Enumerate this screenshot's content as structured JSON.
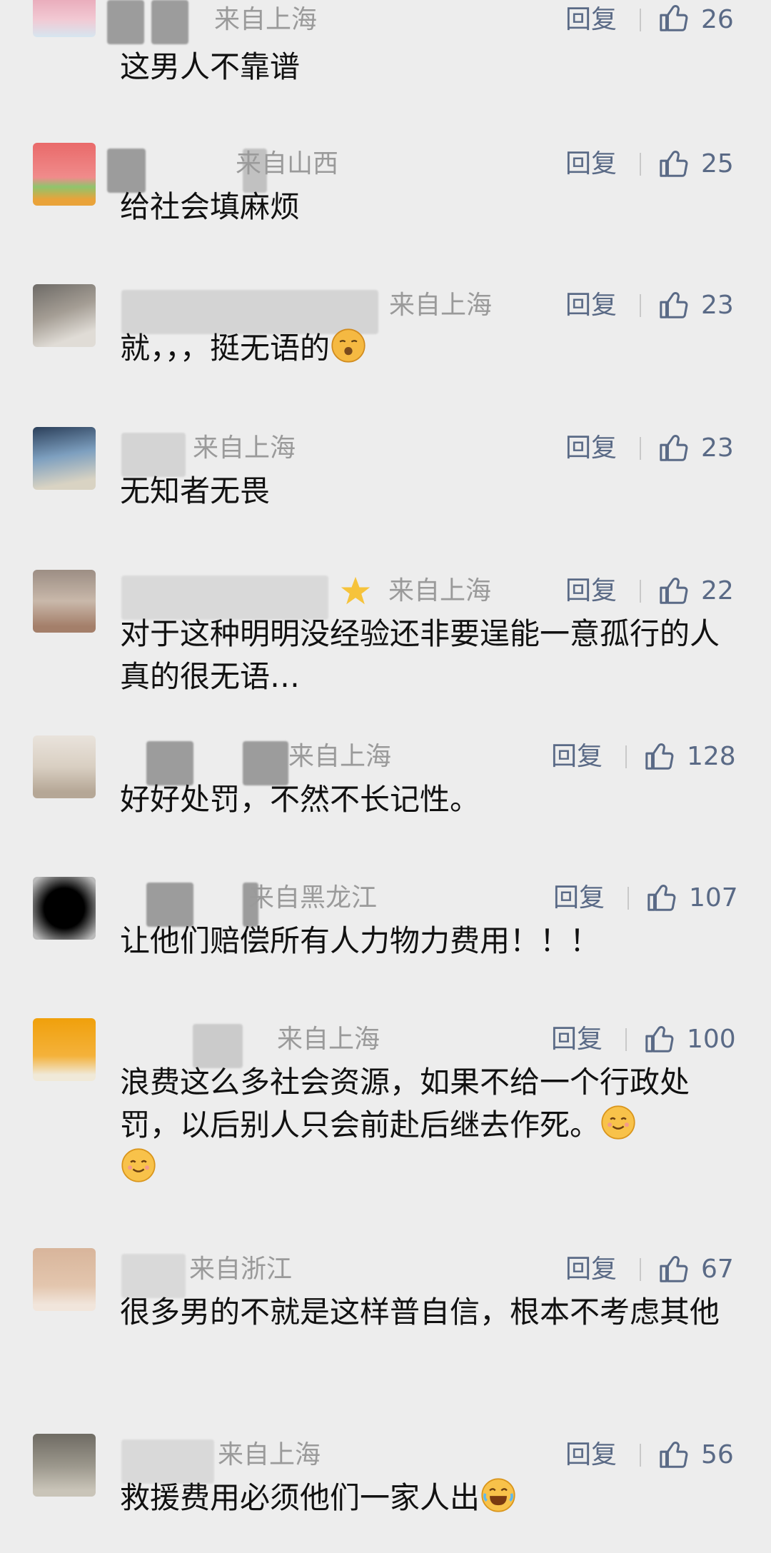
{
  "reply_label": "回复",
  "colors": {
    "action": "#5a6a86",
    "meta": "#9a9a9a",
    "background": "#ededed"
  },
  "icons": {
    "like": "thumbs-up-icon"
  },
  "comments": [
    {
      "location": "来自上海",
      "likes": "26",
      "text": "这男人不靠谱"
    },
    {
      "location": "来自山西",
      "likes": "25",
      "text": "给社会填麻烦"
    },
    {
      "location": "来自上海",
      "likes": "23",
      "text": "就，，，挺无语的",
      "emoji": "kiss-emoji-icon"
    },
    {
      "location": "来自上海",
      "likes": "23",
      "text": "无知者无畏"
    },
    {
      "location": "来自上海",
      "likes": "22",
      "text": "对于这种明明没经验还非要逞能一意孤行的人真的很无语…"
    },
    {
      "location": "来自上海",
      "likes": "128",
      "text": "好好处罚，不然不长记性。"
    },
    {
      "location": "来自黑龙江",
      "likes": "107",
      "text": "让他们赔偿所有人力物力费用！！！"
    },
    {
      "location": "来自上海",
      "likes": "100",
      "text": "浪费这么多社会资源，如果不给一个行政处罚，以后别人只会前赴后继去作死。",
      "emoji": "smile-emoji-icon",
      "emoji2": "smile-emoji-icon"
    },
    {
      "location": "来自浙江",
      "likes": "67",
      "text": "很多男的不就是这样普自信，根本不考虑其他"
    },
    {
      "location": "来自上海",
      "likes": "56",
      "text": "救援费用必须他们一家人出",
      "emoji": "laugh-emoji-icon"
    }
  ]
}
